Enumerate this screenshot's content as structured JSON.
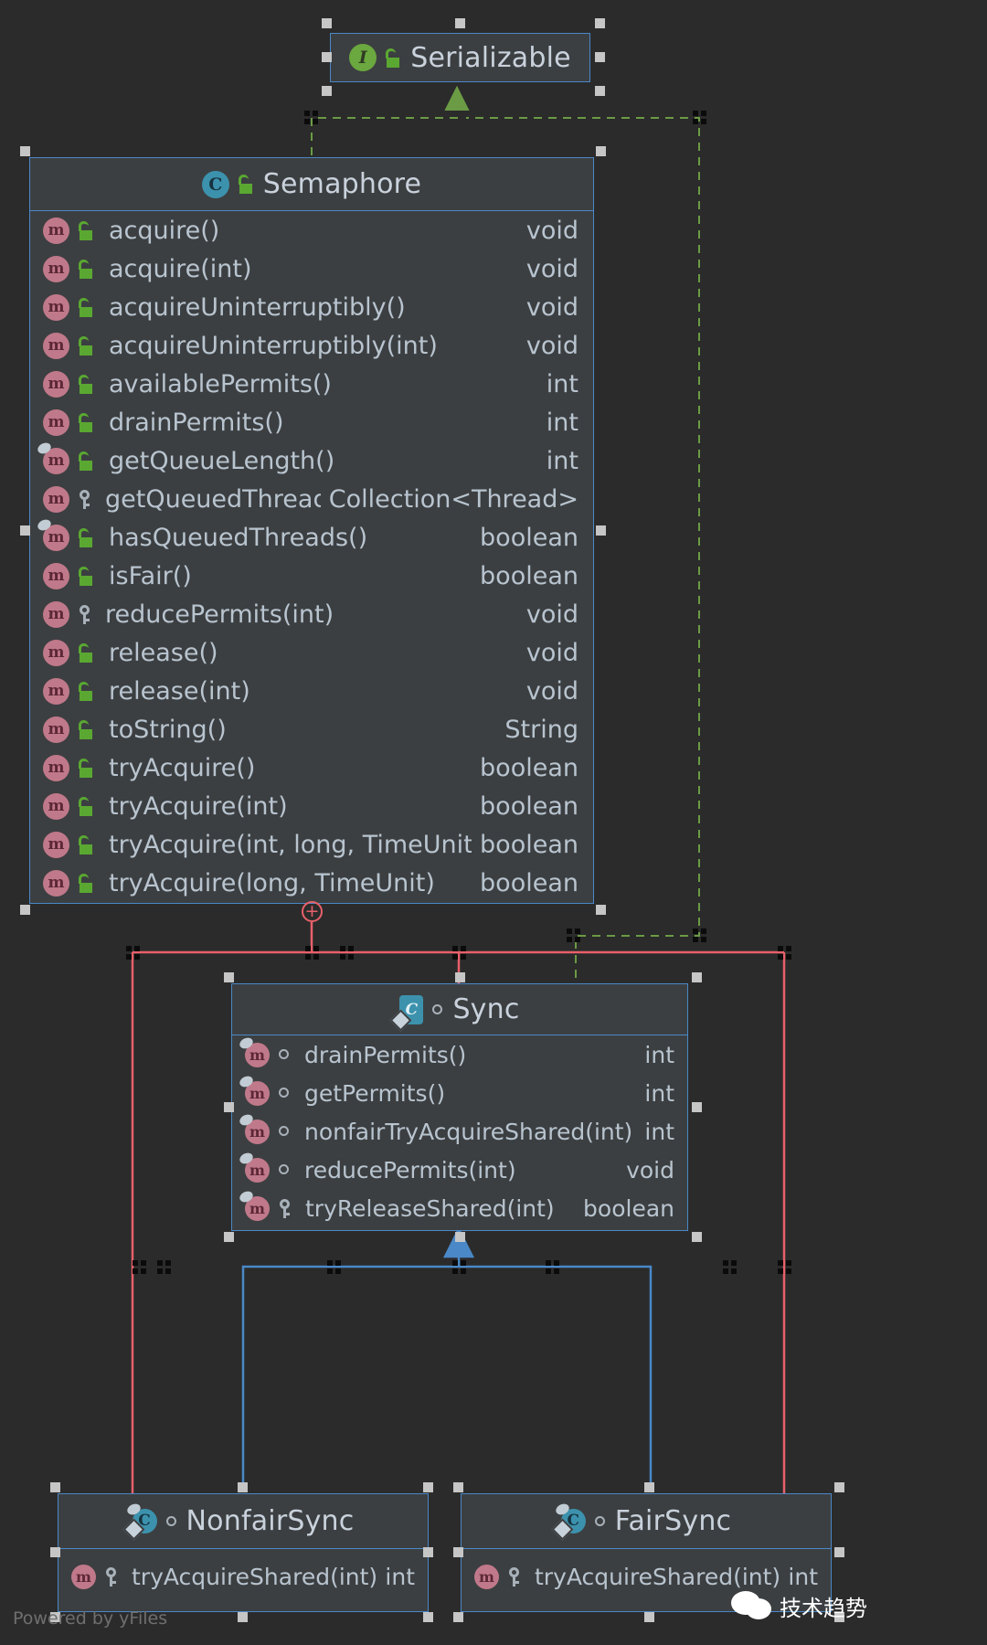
{
  "diagram": {
    "tool": "yFiles",
    "watermark": "Powered by yFiles",
    "wechat_label": "技术趋势",
    "colors": {
      "background": "#2b2b2b",
      "node_fill": "#3c3f41",
      "node_border": "#4a88c7",
      "inheritance_edge": "#4a88c7",
      "nesting_edge": "#e8606a",
      "realization_edge": "#6b9b45",
      "text": "#b8c4cf"
    }
  },
  "nodes": {
    "serializable": {
      "name": "Serializable",
      "stereotype_icon": "interface-icon",
      "visibility_icon": "public-unlocked-icon",
      "members": []
    },
    "semaphore": {
      "name": "Semaphore",
      "stereotype_icon": "class-icon",
      "visibility_icon": "public-unlocked-icon",
      "members": [
        {
          "icon": "method-icon",
          "visibility": "public",
          "name": "acquire()",
          "type": "void"
        },
        {
          "icon": "method-icon",
          "visibility": "public",
          "name": "acquire(int)",
          "type": "void"
        },
        {
          "icon": "method-icon",
          "visibility": "public",
          "name": "acquireUninterruptibly()",
          "type": "void"
        },
        {
          "icon": "method-icon",
          "visibility": "public",
          "name": "acquireUninterruptibly(int)",
          "type": "void"
        },
        {
          "icon": "method-icon",
          "visibility": "public",
          "name": "availablePermits()",
          "type": "int"
        },
        {
          "icon": "method-icon",
          "visibility": "public",
          "name": "drainPermits()",
          "type": "int"
        },
        {
          "icon": "method-icon",
          "visibility": "public",
          "name": "getQueueLength()",
          "type": "int",
          "overridden": true
        },
        {
          "icon": "method-icon",
          "visibility": "protected",
          "name": "getQueuedThreads()",
          "type": "Collection<Thread>"
        },
        {
          "icon": "method-icon",
          "visibility": "public",
          "name": "hasQueuedThreads()",
          "type": "boolean",
          "overridden": true
        },
        {
          "icon": "method-icon",
          "visibility": "public",
          "name": "isFair()",
          "type": "boolean"
        },
        {
          "icon": "method-icon",
          "visibility": "protected",
          "name": "reducePermits(int)",
          "type": "void"
        },
        {
          "icon": "method-icon",
          "visibility": "public",
          "name": "release()",
          "type": "void"
        },
        {
          "icon": "method-icon",
          "visibility": "public",
          "name": "release(int)",
          "type": "void"
        },
        {
          "icon": "method-icon",
          "visibility": "public",
          "name": "toString()",
          "type": "String"
        },
        {
          "icon": "method-icon",
          "visibility": "public",
          "name": "tryAcquire()",
          "type": "boolean"
        },
        {
          "icon": "method-icon",
          "visibility": "public",
          "name": "tryAcquire(int)",
          "type": "boolean"
        },
        {
          "icon": "method-icon",
          "visibility": "public",
          "name": "tryAcquire(int, long, TimeUnit)",
          "type": "boolean"
        },
        {
          "icon": "method-icon",
          "visibility": "public",
          "name": "tryAcquire(long, TimeUnit)",
          "type": "boolean"
        }
      ]
    },
    "sync": {
      "name": "Sync",
      "stereotype_icon": "abstract-class-icon",
      "visibility_icon": "package-private-icon",
      "members": [
        {
          "icon": "method-icon",
          "visibility": "package",
          "name": "drainPermits()",
          "type": "int",
          "overridden": true
        },
        {
          "icon": "method-icon",
          "visibility": "package",
          "name": "getPermits()",
          "type": "int",
          "overridden": true
        },
        {
          "icon": "method-icon",
          "visibility": "package",
          "name": "nonfairTryAcquireShared(int)",
          "type": "int",
          "overridden": true
        },
        {
          "icon": "method-icon",
          "visibility": "package",
          "name": "reducePermits(int)",
          "type": "void",
          "overridden": true
        },
        {
          "icon": "method-icon",
          "visibility": "protected",
          "name": "tryReleaseShared(int)",
          "type": "boolean",
          "overridden": true
        }
      ]
    },
    "nonfairsync": {
      "name": "NonfairSync",
      "stereotype_icon": "final-class-icon",
      "visibility_icon": "package-private-icon",
      "members": [
        {
          "icon": "method-icon",
          "visibility": "protected",
          "name": "tryAcquireShared(int)",
          "type": "int"
        }
      ]
    },
    "fairsync": {
      "name": "FairSync",
      "stereotype_icon": "final-class-icon",
      "visibility_icon": "package-private-icon",
      "members": [
        {
          "icon": "method-icon",
          "visibility": "protected",
          "name": "tryAcquireShared(int)",
          "type": "int"
        }
      ]
    }
  },
  "edges": [
    {
      "name": "semaphore-implements-serializable",
      "kind": "realization",
      "from": "semaphore",
      "to": "serializable"
    },
    {
      "name": "sync-implements-serializable",
      "kind": "realization",
      "from": "sync",
      "to": "serializable"
    },
    {
      "name": "semaphore-nests-sync",
      "kind": "nesting",
      "from": "semaphore",
      "to": "sync"
    },
    {
      "name": "semaphore-nests-nonfairsync",
      "kind": "nesting",
      "from": "semaphore",
      "to": "nonfairsync"
    },
    {
      "name": "semaphore-nests-fairsync",
      "kind": "nesting",
      "from": "semaphore",
      "to": "fairsync"
    },
    {
      "name": "nonfairsync-extends-sync",
      "kind": "generalization",
      "from": "nonfairsync",
      "to": "sync"
    },
    {
      "name": "fairsync-extends-sync",
      "kind": "generalization",
      "from": "fairsync",
      "to": "sync"
    }
  ]
}
